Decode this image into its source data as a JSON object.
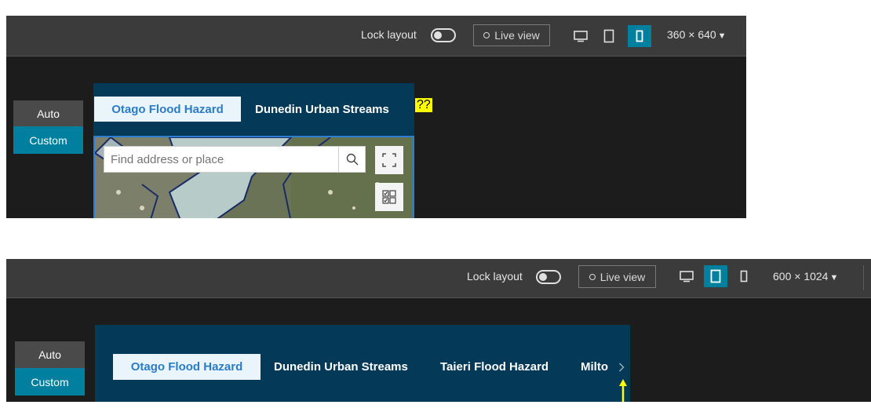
{
  "top": {
    "toolbar": {
      "lock_label": "Lock layout",
      "live_label": "Live view",
      "size_label": "360 × 640",
      "active_device": "mobile"
    },
    "mode": {
      "auto_label": "Auto",
      "custom_label": "Custom"
    },
    "tabs": [
      {
        "label": "Otago Flood Hazard",
        "active": true
      },
      {
        "label": "Dunedin Urban Streams",
        "active": false
      }
    ],
    "search_placeholder": "Find address or place",
    "annotation": "??"
  },
  "bottom": {
    "toolbar": {
      "lock_label": "Lock layout",
      "live_label": "Live view",
      "size_label": "600 × 1024",
      "active_device": "tablet"
    },
    "mode": {
      "auto_label": "Auto",
      "custom_label": "Custom"
    },
    "tabs": [
      {
        "label": "Otago Flood Hazard",
        "active": true
      },
      {
        "label": "Dunedin Urban Streams",
        "active": false
      },
      {
        "label": "Taieri Flood Hazard",
        "active": false
      },
      {
        "label": "Milto",
        "active": false
      }
    ]
  },
  "colors": {
    "accent": "#00809e",
    "app_header": "#043a57",
    "active_tab_text": "#2b7cc7",
    "annotation_highlight": "#ffff00"
  },
  "icons": [
    "toggle-icon",
    "live-dot-icon",
    "desktop-icon",
    "tablet-icon",
    "mobile-icon",
    "dropdown-caret-icon",
    "search-icon",
    "fullscreen-icon",
    "layer-list-icon",
    "chevron-right-icon",
    "annotation-arrow-icon"
  ]
}
